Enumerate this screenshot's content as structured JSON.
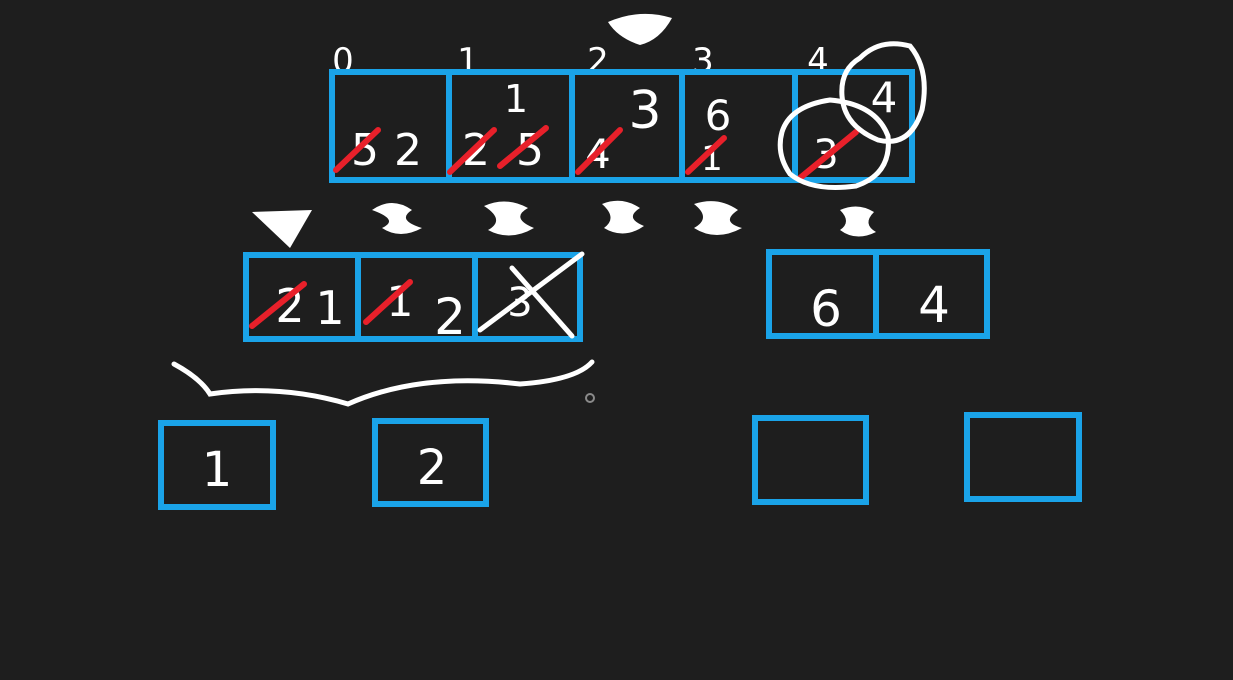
{
  "colors": {
    "background": "#1e1e1e",
    "box": "#1aa3e8",
    "ink": "#ffffff",
    "strike": "#e8202a"
  },
  "top_array": {
    "indices": [
      "0",
      "1",
      "2",
      "3",
      "4"
    ],
    "cells": [
      {
        "crossed": [
          "5"
        ],
        "current": [
          "2"
        ]
      },
      {
        "crossed": [
          "2",
          "5"
        ],
        "current": [],
        "above": "1"
      },
      {
        "crossed": [
          "4"
        ],
        "current": [],
        "above": "3"
      },
      {
        "crossed": [
          "1"
        ],
        "current": [],
        "above": "6"
      },
      {
        "crossed": [
          "3"
        ],
        "current": [],
        "above": "4"
      }
    ]
  },
  "left_array": {
    "cells": [
      {
        "crossed": [
          "2"
        ],
        "current": [
          "1"
        ]
      },
      {
        "crossed": [
          "1"
        ],
        "current": [
          "2"
        ]
      },
      {
        "crossed": [
          "3"
        ],
        "current": []
      }
    ]
  },
  "right_array": {
    "cells": [
      {
        "value": "6"
      },
      {
        "value": "4"
      }
    ]
  },
  "bottom_boxes": [
    {
      "value": "1"
    },
    {
      "value": "2"
    },
    {
      "value": ""
    },
    {
      "value": ""
    }
  ]
}
